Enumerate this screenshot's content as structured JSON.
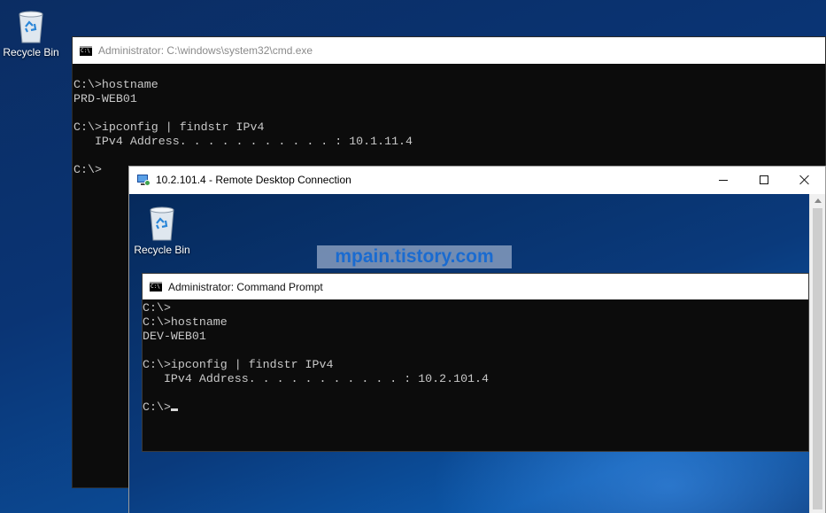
{
  "desktop": {
    "recycle_bin_label": "Recycle Bin"
  },
  "outer_cmd": {
    "title": "Administrator: C:\\windows\\system32\\cmd.exe",
    "lines": [
      "C:\\>hostname",
      "PRD-WEB01",
      "",
      "C:\\>ipconfig | findstr IPv4",
      "   IPv4 Address. . . . . . . . . . . : 10.1.11.4",
      "",
      "C:\\>"
    ]
  },
  "rdp": {
    "title": "10.2.101.4 - Remote Desktop Connection",
    "recycle_bin_label": "Recycle Bin",
    "watermark": "mpain.tistory.com",
    "inner_cmd": {
      "title": "Administrator: Command Prompt",
      "lines": [
        "C:\\>",
        "C:\\>hostname",
        "DEV-WEB01",
        "",
        "C:\\>ipconfig | findstr IPv4",
        "   IPv4 Address. . . . . . . . . . . : 10.2.101.4",
        ""
      ],
      "prompt": "C:\\>"
    }
  },
  "icons": {
    "recycle_bin": "recycle-bin-icon",
    "cmd": "cmd-icon",
    "rdp": "remote-desktop-icon"
  },
  "colors": {
    "console_bg": "#0c0c0c",
    "console_text": "#c8c8c8",
    "watermark_text": "#1a6bd0"
  }
}
